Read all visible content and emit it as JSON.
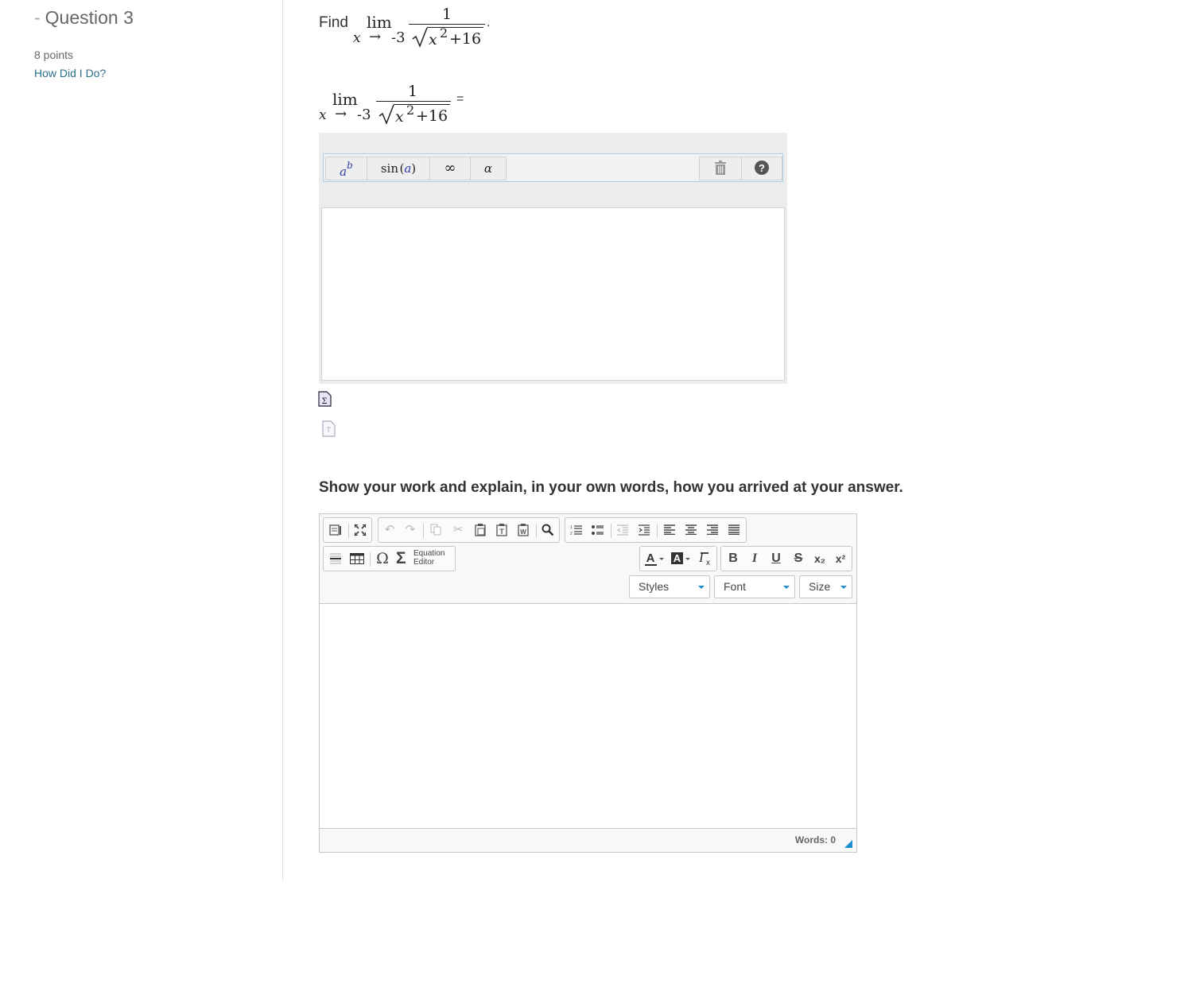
{
  "sidebar": {
    "dash": "-",
    "question_title": "Question 3",
    "points": "8 points",
    "how_link": "How Did I Do?"
  },
  "question": {
    "find_label": "Find",
    "lim": "lim",
    "subscript_var": "x",
    "subscript_arrow": "→",
    "subscript_value": "-3",
    "numerator": "1",
    "radicand_var": "x",
    "radicand_exp": "2",
    "radicand_rest": "+16",
    "period": ".",
    "equals": "="
  },
  "math_toolbar": {
    "power_base": "a",
    "power_exp": "b",
    "trig": "sin",
    "trig_arg": "a",
    "infinity": "∞",
    "greek": "α",
    "delete_icon": "trash-icon",
    "help_icon": "help-icon"
  },
  "work_prompt": "Show your work and explain, in your own words, how you arrived at your answer.",
  "rich_editor": {
    "equation_editor_label_1": "Equation",
    "equation_editor_label_2": "Editor",
    "styles": "Styles",
    "font": "Font",
    "size": "Size",
    "words": "Words: 0",
    "bold": "B",
    "italic": "I",
    "underline": "U",
    "strike": "S",
    "subscript": "x₂",
    "superscript": "x²",
    "omega": "Ω",
    "sigma": "Σ",
    "accent_color": "#1a8fd0"
  }
}
